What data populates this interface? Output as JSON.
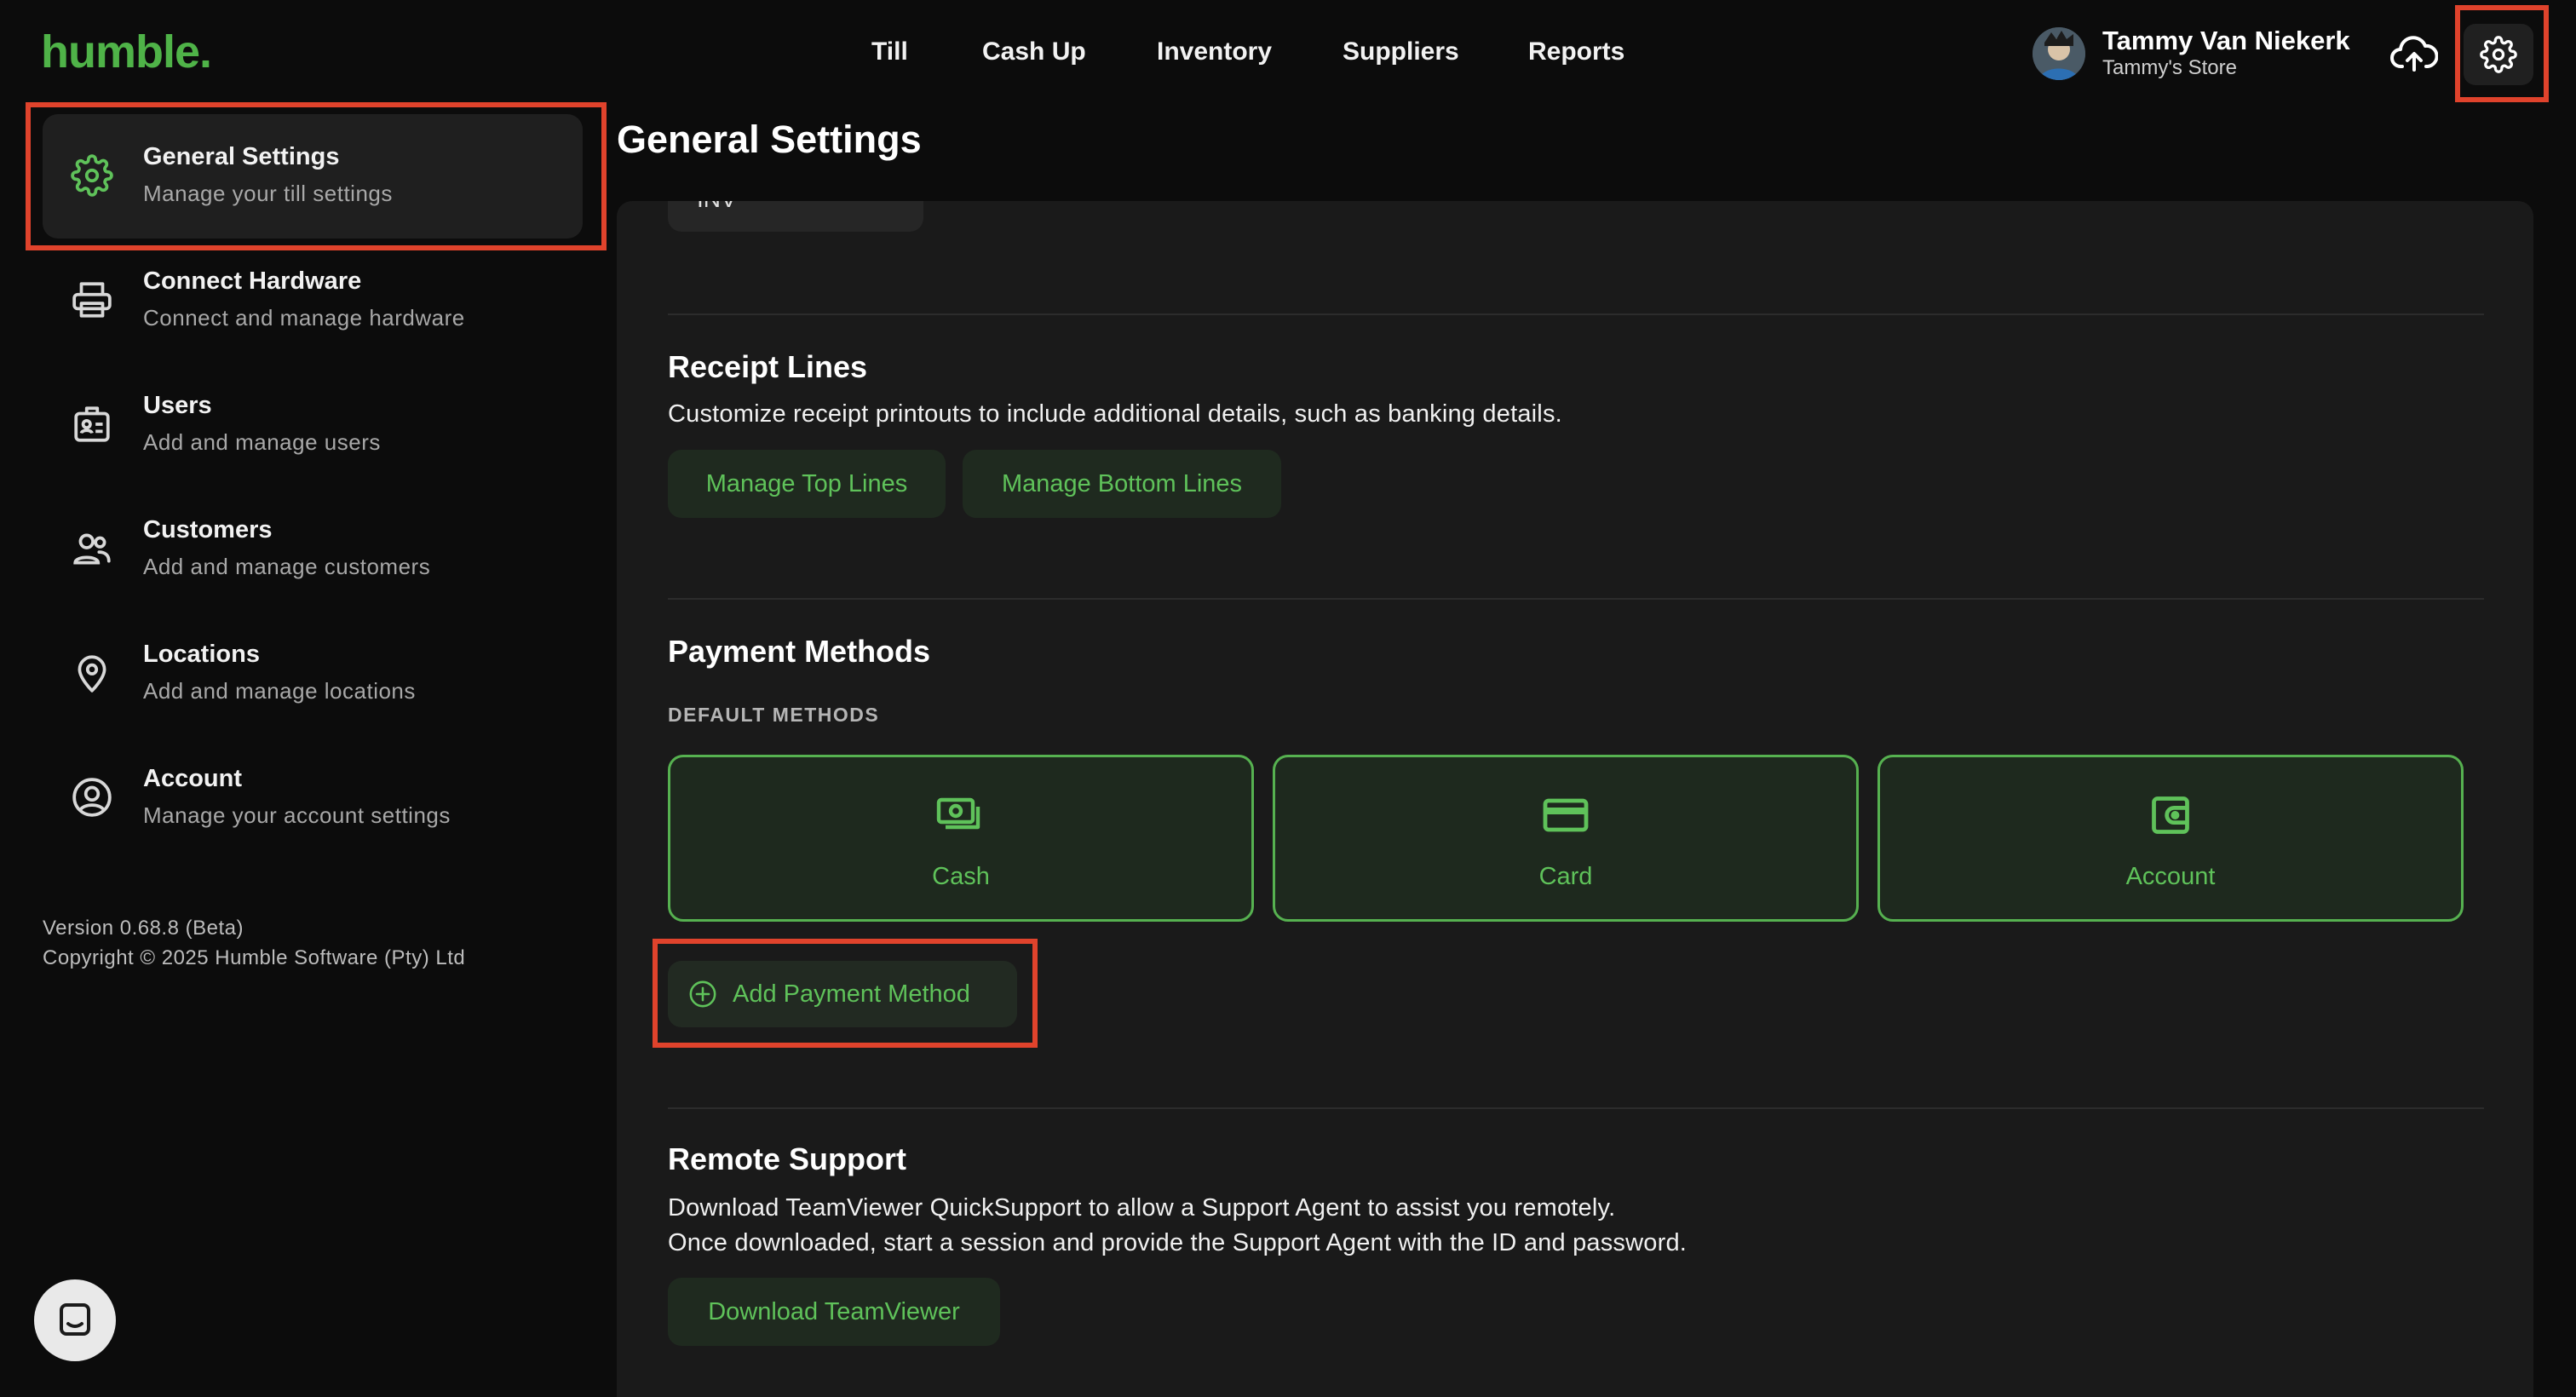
{
  "header": {
    "logo": "humble.",
    "nav": [
      "Till",
      "Cash Up",
      "Inventory",
      "Suppliers",
      "Reports"
    ],
    "user_name": "Tammy Van Niekerk",
    "user_store": "Tammy's Store"
  },
  "sidebar": {
    "items": [
      {
        "title": "General Settings",
        "subtitle": "Manage your till settings",
        "icon": "gear-icon"
      },
      {
        "title": "Connect Hardware",
        "subtitle": "Connect and manage hardware",
        "icon": "printer-icon"
      },
      {
        "title": "Users",
        "subtitle": "Add and manage users",
        "icon": "id-badge-icon"
      },
      {
        "title": "Customers",
        "subtitle": "Add and manage customers",
        "icon": "people-icon"
      },
      {
        "title": "Locations",
        "subtitle": "Add and manage locations",
        "icon": "location-pin-icon"
      },
      {
        "title": "Account",
        "subtitle": "Manage your account settings",
        "icon": "user-circle-icon"
      }
    ],
    "version": "Version 0.68.8 (Beta)",
    "copyright": "Copyright © 2025 Humble Software (Pty) Ltd"
  },
  "main": {
    "page_title": "General Settings",
    "inv_value": "INV",
    "receipt_lines": {
      "title": "Receipt Lines",
      "description": "Customize receipt printouts to include additional details, such as banking details.",
      "top_button": "Manage Top Lines",
      "bottom_button": "Manage Bottom Lines"
    },
    "payment_methods": {
      "title": "Payment Methods",
      "default_label": "DEFAULT METHODS",
      "methods": [
        {
          "label": "Cash",
          "icon": "cash-icon"
        },
        {
          "label": "Card",
          "icon": "credit-card-icon"
        },
        {
          "label": "Account",
          "icon": "wallet-icon"
        }
      ],
      "add_button": "Add Payment Method"
    },
    "remote_support": {
      "title": "Remote Support",
      "line1": "Download TeamViewer QuickSupport to allow a Support Agent to assist you remotely.",
      "line2": "Once downloaded, start a session and provide the Support Agent with the ID and password.",
      "button": "Download TeamViewer"
    }
  },
  "colors": {
    "accent_green": "#5fc25a",
    "background": "#0c0c0c",
    "panel": "#1a1a1a",
    "highlight_red": "#e0432c"
  }
}
